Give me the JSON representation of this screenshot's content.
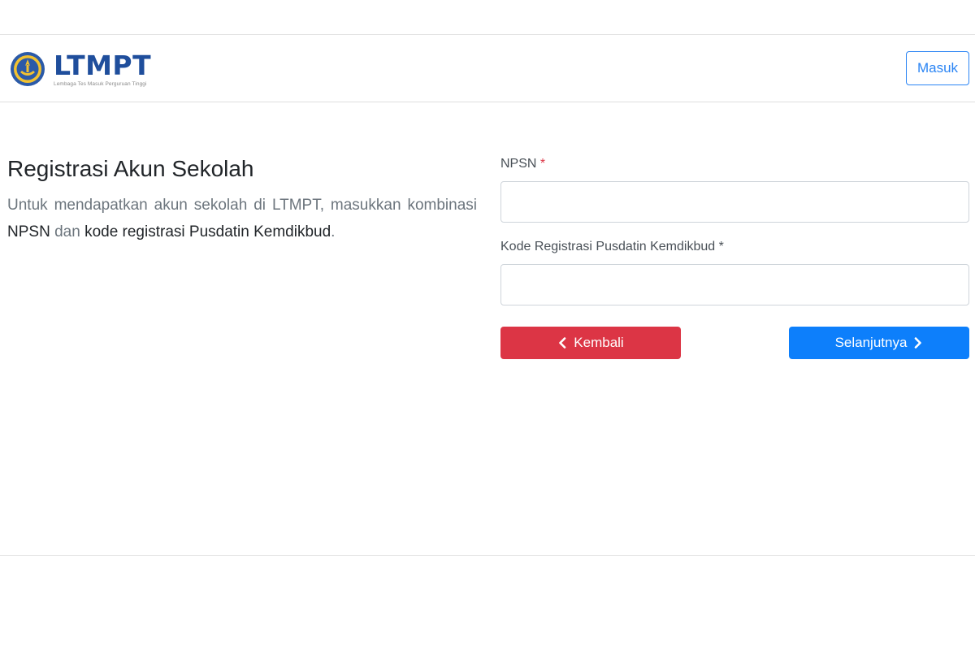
{
  "header": {
    "brand_title": "LTMPT",
    "brand_subtitle": "Lembaga Tes Masuk Perguruan Tinggi",
    "login_label": "Masuk"
  },
  "intro": {
    "title": "Registrasi Akun Sekolah",
    "desc_part1": "Untuk mendapatkan akun sekolah di LTMPT, masukkan kombinasi ",
    "desc_npsn": "NPSN",
    "desc_part2": " dan ",
    "desc_kode": "kode registrasi Pusdatin Kemdikbud",
    "desc_end": "."
  },
  "form": {
    "npsn_label": "NPSN",
    "npsn_required": "*",
    "npsn_value": "",
    "kode_label": "Kode Registrasi Pusdatin Kemdikbud",
    "kode_required": "*",
    "kode_value": "",
    "back_label": "Kembali",
    "next_label": "Selanjutnya"
  },
  "colors": {
    "brand": "#1f4e9c",
    "primary": "#0d7ffb",
    "danger": "#dc3545"
  }
}
